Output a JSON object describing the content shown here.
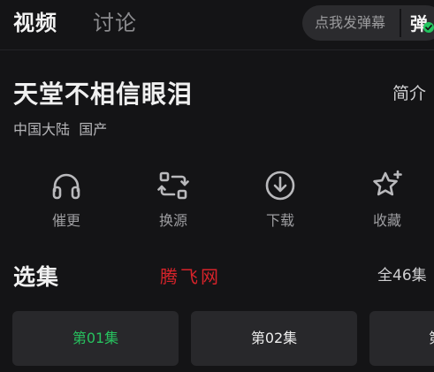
{
  "tabs": {
    "video": "视频",
    "discuss": "讨论"
  },
  "danmaku": {
    "placeholder": "点我发弹幕",
    "toggle_label": "弹",
    "toggle_on_color": "#22c55e"
  },
  "show": {
    "title": "天堂不相信眼泪",
    "intro_label": "简介",
    "region": "中国大陆",
    "category": "国产"
  },
  "actions": [
    {
      "label": "催更",
      "icon": "headphones-icon"
    },
    {
      "label": "换源",
      "icon": "switch-source-icon"
    },
    {
      "label": "下载",
      "icon": "download-icon"
    },
    {
      "label": "收藏",
      "icon": "star-icon"
    }
  ],
  "episodes": {
    "section_title": "选集",
    "watermark": "腾飞网",
    "total_label": "全46集",
    "items": [
      {
        "label": "第01集",
        "active": true
      },
      {
        "label": "第02集",
        "active": false
      },
      {
        "label": "第",
        "active": false
      }
    ],
    "active_color": "#27c25f"
  }
}
